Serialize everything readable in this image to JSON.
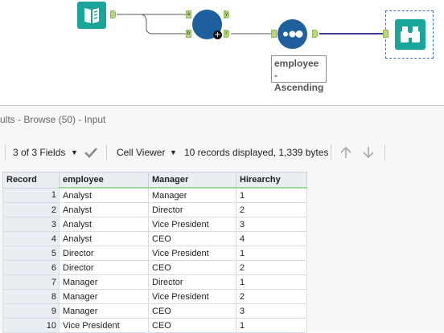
{
  "workflow": {
    "anchor_labels": {
      "a": "a",
      "b": "b",
      "y": "y",
      "r": "r"
    },
    "sort_tool_label": "employee - Ascending"
  },
  "results": {
    "title": "ults - Browse (50) - Input",
    "fields_label": "3 of 3 Fields",
    "viewer_label": "Cell Viewer",
    "records_info": "10 records displayed, 1,339 bytes"
  },
  "grid": {
    "columns": [
      "Record",
      "employee",
      "Manager",
      "Hirearchy"
    ],
    "rows": [
      {
        "record": "1",
        "employee": "Analyst",
        "manager": "Manager",
        "hierarchy": "1"
      },
      {
        "record": "2",
        "employee": "Analyst",
        "manager": "Director",
        "hierarchy": "2"
      },
      {
        "record": "3",
        "employee": "Analyst",
        "manager": "Vice President",
        "hierarchy": "3"
      },
      {
        "record": "4",
        "employee": "Analyst",
        "manager": "CEO",
        "hierarchy": "4"
      },
      {
        "record": "5",
        "employee": "Director",
        "manager": "Vice President",
        "hierarchy": "1"
      },
      {
        "record": "6",
        "employee": "Director",
        "manager": "CEO",
        "hierarchy": "2"
      },
      {
        "record": "7",
        "employee": "Manager",
        "manager": "Director",
        "hierarchy": "1"
      },
      {
        "record": "8",
        "employee": "Manager",
        "manager": "Vice President",
        "hierarchy": "2"
      },
      {
        "record": "9",
        "employee": "Manager",
        "manager": "CEO",
        "hierarchy": "3"
      },
      {
        "record": "10",
        "employee": "Vice President",
        "manager": "CEO",
        "hierarchy": "1"
      }
    ]
  },
  "colors": {
    "input_tool": "#1aa59a",
    "join_tool": "#1f5f9e",
    "sort_tool": "#1f5f9e",
    "browse_tool": "#1aa59a",
    "anchor": "#b5d77a",
    "connection": "#5a5a5a",
    "selected_connection": "#3b3a9e"
  },
  "icons": {
    "input": "book-icon",
    "join": "join-icon",
    "sort": "sort-dots-icon",
    "browse": "binoculars-icon",
    "fields_check": "check-icon",
    "prev": "arrow-up-icon",
    "next": "arrow-down-icon"
  }
}
